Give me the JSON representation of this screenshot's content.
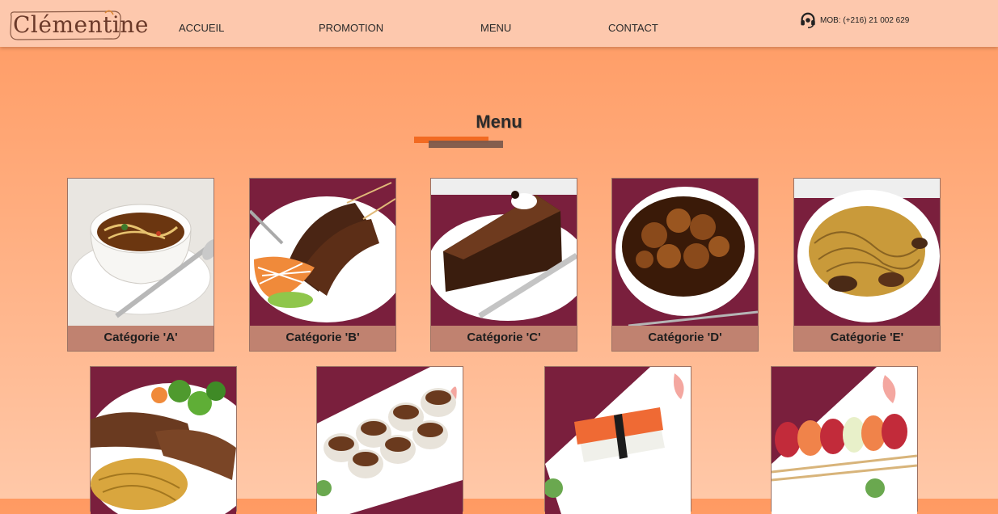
{
  "header": {
    "logo_text": "Clémentine",
    "nav": [
      "ACCUEIL",
      "PROMOTION",
      "MENU",
      "CONTACT"
    ],
    "phone": "MOB: (+216) 21 002 629"
  },
  "main": {
    "title": "Menu",
    "categories": [
      {
        "label": "Catégorie 'A'",
        "image": "soup"
      },
      {
        "label": "Catégorie 'B'",
        "image": "beef-skewers"
      },
      {
        "label": "Catégorie 'C'",
        "image": "chocolate-cake"
      },
      {
        "label": "Catégorie 'D'",
        "image": "glazed-chicken"
      },
      {
        "label": "Catégorie 'E'",
        "image": "noodles"
      }
    ],
    "second_row": [
      {
        "image": "steak-noodles"
      },
      {
        "image": "sushi-rolls"
      },
      {
        "image": "salmon-nigiri"
      },
      {
        "image": "rainbow-roll"
      }
    ]
  },
  "colors": {
    "header_bg": "#fdc8ad",
    "accent": "#f26a21",
    "label_bg": "#c08270",
    "placemat": "#7a1f3d"
  }
}
